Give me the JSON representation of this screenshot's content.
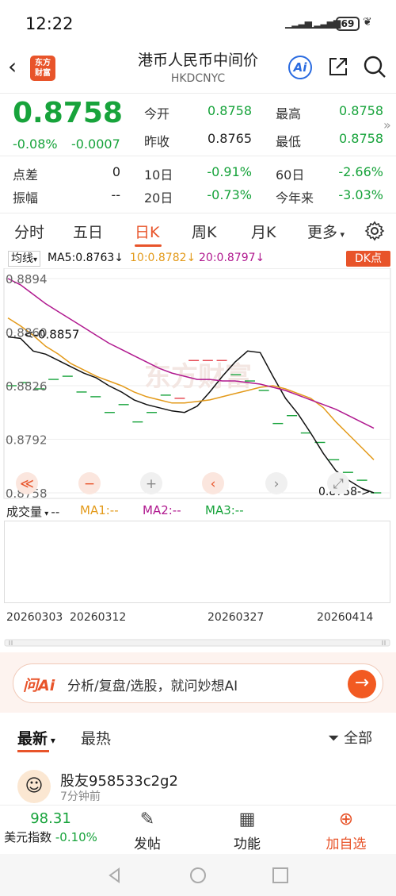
{
  "status": {
    "time": "12:22",
    "battery": "69"
  },
  "nav": {
    "logo_line1": "东方",
    "logo_line2": "财富",
    "title": "港币人民币中间价",
    "subtitle": "HKDCNYC"
  },
  "quote": {
    "price": "0.8758",
    "change_pct": "-0.08%",
    "change_abs": "-0.0007",
    "rows": [
      {
        "l1": "今开",
        "v1": "0.8758",
        "l2": "最高",
        "v2": "0.8758"
      },
      {
        "l1": "昨收",
        "v1": "0.8765",
        "l2": "最低",
        "v2": "0.8758"
      }
    ],
    "stats": [
      {
        "a": "点差",
        "av": "0",
        "b": "10日",
        "bv": "-0.91%",
        "c": "60日",
        "cv": "-2.66%"
      },
      {
        "a": "振幅",
        "av": "--",
        "b": "20日",
        "bv": "-0.73%",
        "c": "今年来",
        "cv": "-3.03%"
      }
    ]
  },
  "tabs": [
    "分时",
    "五日",
    "日K",
    "周K",
    "月K",
    "更多"
  ],
  "ma_legend": {
    "selector": "均线",
    "ma5": "MA5:0.8763↓",
    "ma10": "10:0.8782↓",
    "ma20": "20:0.8797↓",
    "dk": "DK点"
  },
  "chart_data": {
    "type": "line",
    "y_ticks": [
      "0.8894",
      "0.8860",
      "0.8826",
      "0.8792",
      "0.8758"
    ],
    "ylim": [
      0.8758,
      0.8894
    ],
    "annotations": [
      "<-0.8857",
      "0.8758->"
    ],
    "x_tick_labels": [
      "20260303",
      "20260312",
      "20260327",
      "20260414"
    ],
    "watermark": "东方财富",
    "series": [
      {
        "name": "MA5",
        "color": "#111111",
        "values": [
          0.8857,
          0.8856,
          0.8848,
          0.8846,
          0.8842,
          0.8838,
          0.8834,
          0.8831,
          0.8826,
          0.8822,
          0.8817,
          0.8814,
          0.8812,
          0.881,
          0.8809,
          0.8813,
          0.8822,
          0.8832,
          0.8841,
          0.8848,
          0.8847,
          0.8832,
          0.8818,
          0.8808,
          0.8796,
          0.8783,
          0.8772,
          0.8766,
          0.8761,
          0.8758
        ]
      },
      {
        "name": "MA10",
        "color": "#e39a1a",
        "values": [
          0.8869,
          0.8864,
          0.8858,
          0.8851,
          0.8846,
          0.884,
          0.8836,
          0.8832,
          0.8829,
          0.8826,
          0.8822,
          0.8819,
          0.8817,
          0.8815,
          0.8815,
          0.8816,
          0.8817,
          0.8819,
          0.8821,
          0.8823,
          0.8825,
          0.8826,
          0.8824,
          0.8821,
          0.8818,
          0.8812,
          0.8803,
          0.8795,
          0.8787,
          0.8779
        ]
      },
      {
        "name": "MA20",
        "color": "#b0198f",
        "values": [
          0.8894,
          0.889,
          0.8884,
          0.8878,
          0.8873,
          0.8868,
          0.8863,
          0.8858,
          0.8853,
          0.8849,
          0.8845,
          0.8841,
          0.8837,
          0.8834,
          0.8832,
          0.883,
          0.883,
          0.8829,
          0.8829,
          0.8828,
          0.8827,
          0.8825,
          0.8823,
          0.882,
          0.8817,
          0.8814,
          0.8811,
          0.8807,
          0.8803,
          0.8799
        ]
      }
    ],
    "ticks": [
      0.8826,
      0.8828,
      0.8824,
      0.883,
      0.8832,
      0.8822,
      0.8819,
      0.8809,
      0.8814,
      0.8803,
      0.8809,
      0.882,
      0.8818,
      0.8842,
      0.8842,
      0.8842,
      0.8833,
      0.8829,
      0.8823,
      0.8802,
      0.8807,
      0.8796,
      0.879,
      0.8779,
      0.8771,
      0.8766,
      0.8758
    ]
  },
  "chart_controls": [
    "≪",
    "−",
    "+",
    "‹",
    "›",
    "⤢"
  ],
  "volume": {
    "selector": "成交量",
    "ma1": "MA1:--",
    "ma2": "MA2:--",
    "ma3": "MA3:--",
    "dash": "--"
  },
  "dates": [
    "20260303",
    "20260312",
    "20260327",
    "20260414"
  ],
  "ai_bar": {
    "logo": "问Ai",
    "prompt": "分析/复盘/选股，就问妙想AI"
  },
  "comment_tabs": {
    "latest": "最新",
    "hot": "最热",
    "filter": "全部"
  },
  "post": {
    "user": "股友958533c2g2",
    "time": "7分钟前"
  },
  "bottom": {
    "index_value": "98.31",
    "index_name": "美元指数",
    "index_change": "-0.10%",
    "post": "发帖",
    "func": "功能",
    "add": "加自选"
  }
}
